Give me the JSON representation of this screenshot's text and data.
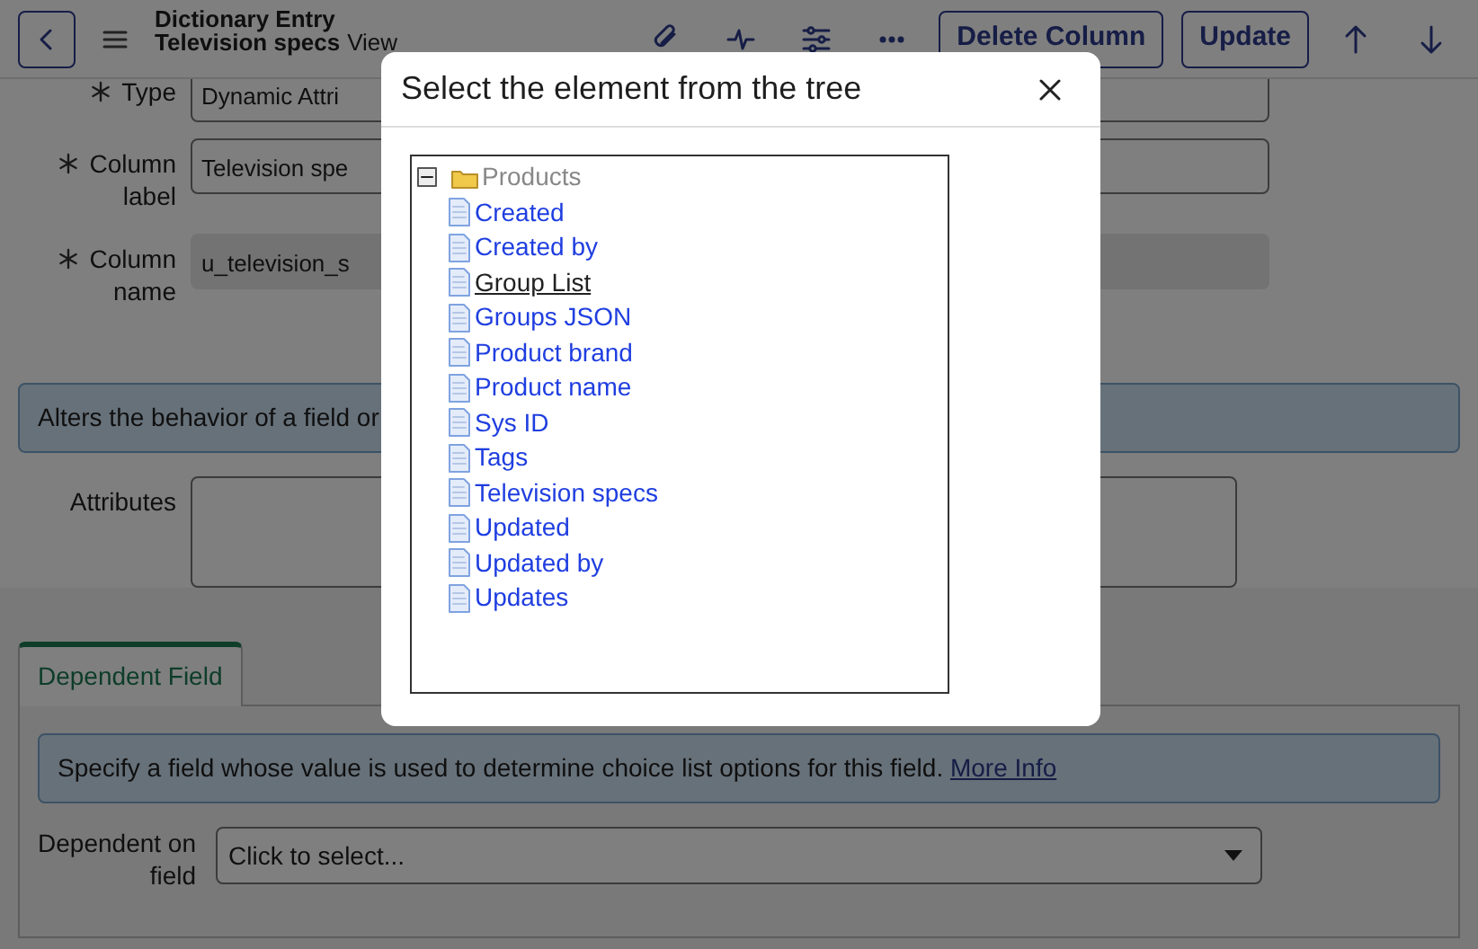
{
  "header": {
    "title": "Dictionary Entry",
    "subtitle": "Television specs",
    "view": "View",
    "buttons": [
      "Delete Column",
      "Update"
    ]
  },
  "fields": [
    {
      "label": "Type",
      "value": "Dynamic Attri",
      "required": true,
      "readonly": false
    },
    {
      "label": "Column label",
      "value": "Television spe",
      "required": true,
      "readonly": false
    },
    {
      "label": "Column name",
      "value": "u_television_s",
      "required": true,
      "readonly": true
    }
  ],
  "info": "Alters the behavior of a field or",
  "attributes_label": "Attributes",
  "tabs": [
    {
      "label": "Dependent Field",
      "selected": true
    }
  ],
  "dependent_info": {
    "text": "Specify a field whose value is used to determine choice list options for this field.",
    "link": "More Info"
  },
  "dependent_field": {
    "label": "Dependent on field",
    "placeholder": "Click to select..."
  },
  "modal": {
    "title": "Select the element from the tree",
    "tree": {
      "label": "Products",
      "expanded": true,
      "children": [
        {
          "label": "Created",
          "hovered": false
        },
        {
          "label": "Created by",
          "hovered": false
        },
        {
          "label": "Group List",
          "hovered": true
        },
        {
          "label": "Groups JSON",
          "hovered": false
        },
        {
          "label": "Product brand",
          "hovered": false
        },
        {
          "label": "Product name",
          "hovered": false
        },
        {
          "label": "Sys ID",
          "hovered": false
        },
        {
          "label": "Tags",
          "hovered": false
        },
        {
          "label": "Television specs",
          "hovered": false
        },
        {
          "label": "Updated",
          "hovered": false
        },
        {
          "label": "Updated by",
          "hovered": false
        },
        {
          "label": "Updates",
          "hovered": false
        }
      ]
    }
  }
}
